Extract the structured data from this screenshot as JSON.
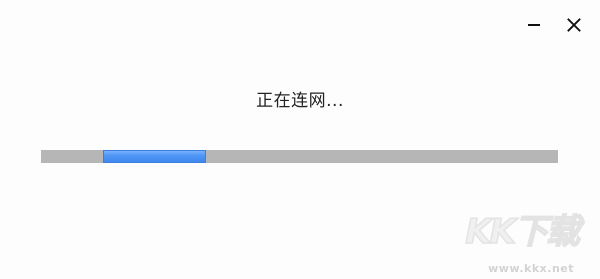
{
  "window": {
    "minimize_icon": "minimize-icon",
    "close_icon": "close-icon"
  },
  "status": {
    "text": "正在连网..."
  },
  "progress": {
    "type": "indeterminate",
    "track_color": "#b6b6b6",
    "bar_color": "#4d95f5",
    "chunk_start": 0.12,
    "chunk_end": 0.32
  },
  "watermark": {
    "logo": "KK下载",
    "url": "www.kkx.net"
  }
}
